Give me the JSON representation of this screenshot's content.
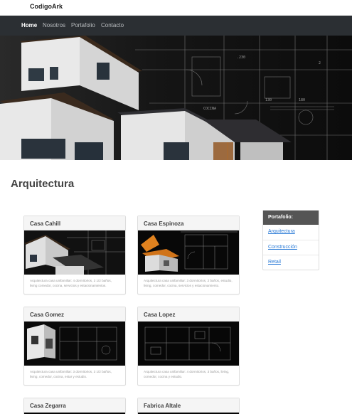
{
  "brand": "CodigoArk",
  "nav": {
    "items": [
      "Home",
      "Nosotros",
      "Portafolio",
      "Contacto"
    ]
  },
  "page_title": "Arquitectura",
  "cards": [
    {
      "title": "Casa Cahill",
      "text": "Arquitectura casa unifamiliar: 4 dormitorios, 3 1/2 baños, living comedor, cocina, servicios y estacionamientos."
    },
    {
      "title": "Casa Espinoza",
      "text": "Arquitectura casa unifamiliar: 3 dormitorios, 2 baños, estudio, living, comedor, cocina, servicios y estacionamiento."
    },
    {
      "title": "Casa Gomez",
      "text": "Arquitectura casa unifamiliar: 3 dormitorios, 3 1/2 baños, living, comedor, cocina, estar y estudio."
    },
    {
      "title": "Casa Lopez",
      "text": "Arquitectura casa unifamiliar: 4 dormitorios, 3 baños, living, comedor, cocina y estudio."
    },
    {
      "title": "Casa Zegarra",
      "text": ""
    },
    {
      "title": "Fabrica Altale",
      "text": ""
    }
  ],
  "sidebar": {
    "heading": "Portafolio:",
    "items": [
      "Arquitectura",
      "Construcción",
      "Retail"
    ]
  },
  "colors": {
    "nav_bg": "#2b2f33",
    "link": "#2a7ad6",
    "sidebar_head_bg": "#555555"
  }
}
